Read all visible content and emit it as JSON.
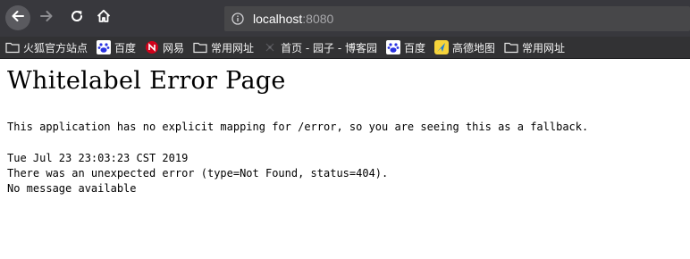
{
  "navbar": {
    "back_icon": "arrow-left-icon",
    "forward_icon": "arrow-right-icon",
    "reload_icon": "reload-icon",
    "home_icon": "home-icon",
    "url": {
      "info_icon": "info-icon",
      "host": "localhost",
      "port": ":8080"
    }
  },
  "bookmarks": {
    "items": [
      {
        "label": "火狐官方站点",
        "icon": "folder-icon"
      },
      {
        "label": "百度",
        "icon": "baidu-paw-icon"
      },
      {
        "label": "网易",
        "icon": "netease-icon"
      },
      {
        "label": "常用网址",
        "icon": "folder-icon"
      },
      {
        "label": "首页 - 园子 - 博客园",
        "icon": "cnblogs-icon"
      },
      {
        "label": "百度",
        "icon": "baidu-paw-icon"
      },
      {
        "label": "高德地图",
        "icon": "amap-icon"
      },
      {
        "label": "常用网址",
        "icon": "folder-icon"
      }
    ]
  },
  "page": {
    "title": "Whitelabel Error Page",
    "description": "This application has no explicit mapping for /error, so you are seeing this as a fallback.",
    "timestamp": "Tue Jul 23 23:03:23 CST 2019",
    "error_line": "There was an unexpected error (type=Not Found, status=404).",
    "message": "No message available"
  },
  "colors": {
    "toolbar_bg": "#38383d",
    "bookmarks_bg": "#323234",
    "urlbar_bg": "#474749",
    "page_bg": "#ffffff"
  }
}
